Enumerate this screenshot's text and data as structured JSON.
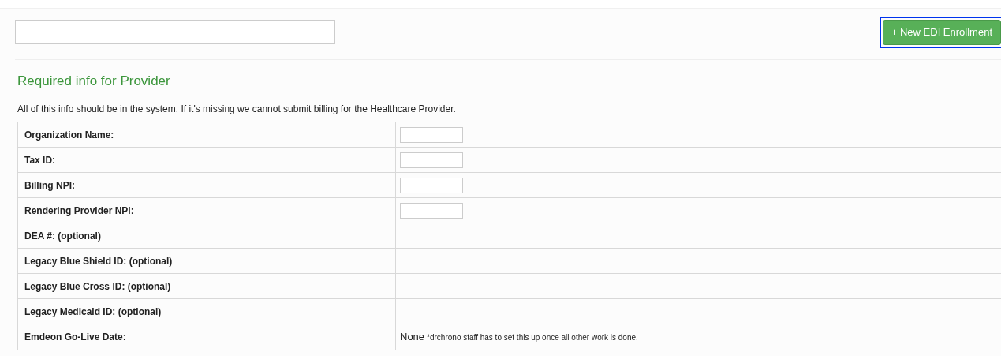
{
  "action_button": {
    "label": "+ New EDI Enrollment",
    "focused": true
  },
  "heading": "Required info for Provider",
  "description": "All of this info should be in the system. If it's missing we cannot submit billing for the Healthcare Provider.",
  "rows": [
    {
      "label": "Organization Name:",
      "kind": "field"
    },
    {
      "label": "Tax ID:",
      "kind": "field"
    },
    {
      "label": "Billing NPI:",
      "kind": "field"
    },
    {
      "label": "Rendering Provider NPI:",
      "kind": "field"
    },
    {
      "label": "DEA #: (optional)",
      "kind": "empty"
    },
    {
      "label": "Legacy Blue Shield ID: (optional)",
      "kind": "empty"
    },
    {
      "label": "Legacy Blue Cross ID: (optional)",
      "kind": "empty"
    },
    {
      "label": "Legacy Medicaid ID: (optional)",
      "kind": "empty"
    },
    {
      "label": "Emdeon Go-Live Date:",
      "kind": "text",
      "value": "None",
      "note": "*drchrono staff has to set this up once all other work is done."
    }
  ]
}
